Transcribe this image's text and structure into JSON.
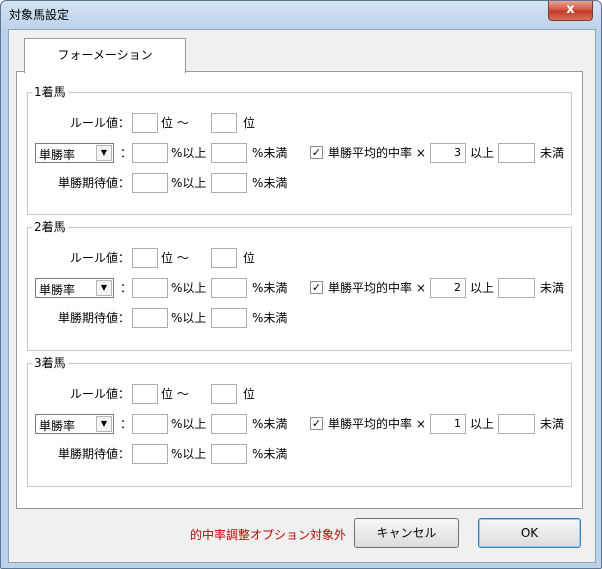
{
  "window": {
    "title": "対象馬設定",
    "close_glyph": "x"
  },
  "tab": {
    "label": "フォーメーション"
  },
  "groups": [
    {
      "title": "1着馬",
      "rule_label": "ルール値：",
      "rank_from_suffix": "位 〜",
      "rank_to_suffix": "位",
      "combo_value": "単勝率",
      "colon": "：",
      "pct_above": "%以上",
      "pct_below": "%未満",
      "check_label": "単勝平均的中率 ×",
      "check_checked": true,
      "multiplier": "3",
      "above": "以上",
      "below": "未満",
      "expect_label": "単勝期待値：",
      "expect_above": "%以上",
      "expect_below": "%未満"
    },
    {
      "title": "2着馬",
      "rule_label": "ルール値：",
      "rank_from_suffix": "位 〜",
      "rank_to_suffix": "位",
      "combo_value": "単勝率",
      "colon": "：",
      "pct_above": "%以上",
      "pct_below": "%未満",
      "check_label": "単勝平均的中率 ×",
      "check_checked": true,
      "multiplier": "2",
      "above": "以上",
      "below": "未満",
      "expect_label": "単勝期待値：",
      "expect_above": "%以上",
      "expect_below": "%未満"
    },
    {
      "title": "3着馬",
      "rule_label": "ルール値：",
      "rank_from_suffix": "位 〜",
      "rank_to_suffix": "位",
      "combo_value": "単勝率",
      "colon": "：",
      "pct_above": "%以上",
      "pct_below": "%未満",
      "check_label": "単勝平均的中率 ×",
      "check_checked": true,
      "multiplier": "1",
      "above": "以上",
      "below": "未満",
      "expect_label": "単勝期待値：",
      "expect_above": "%以上",
      "expect_below": "%未満"
    }
  ],
  "footer": {
    "note": "的中率調整オプション対象外",
    "cancel_label": "キャンセル",
    "ok_label": "OK"
  },
  "colors": {
    "note": "#c00000",
    "title_bar": "#bcd2ea",
    "close_button": "#c1361f"
  }
}
